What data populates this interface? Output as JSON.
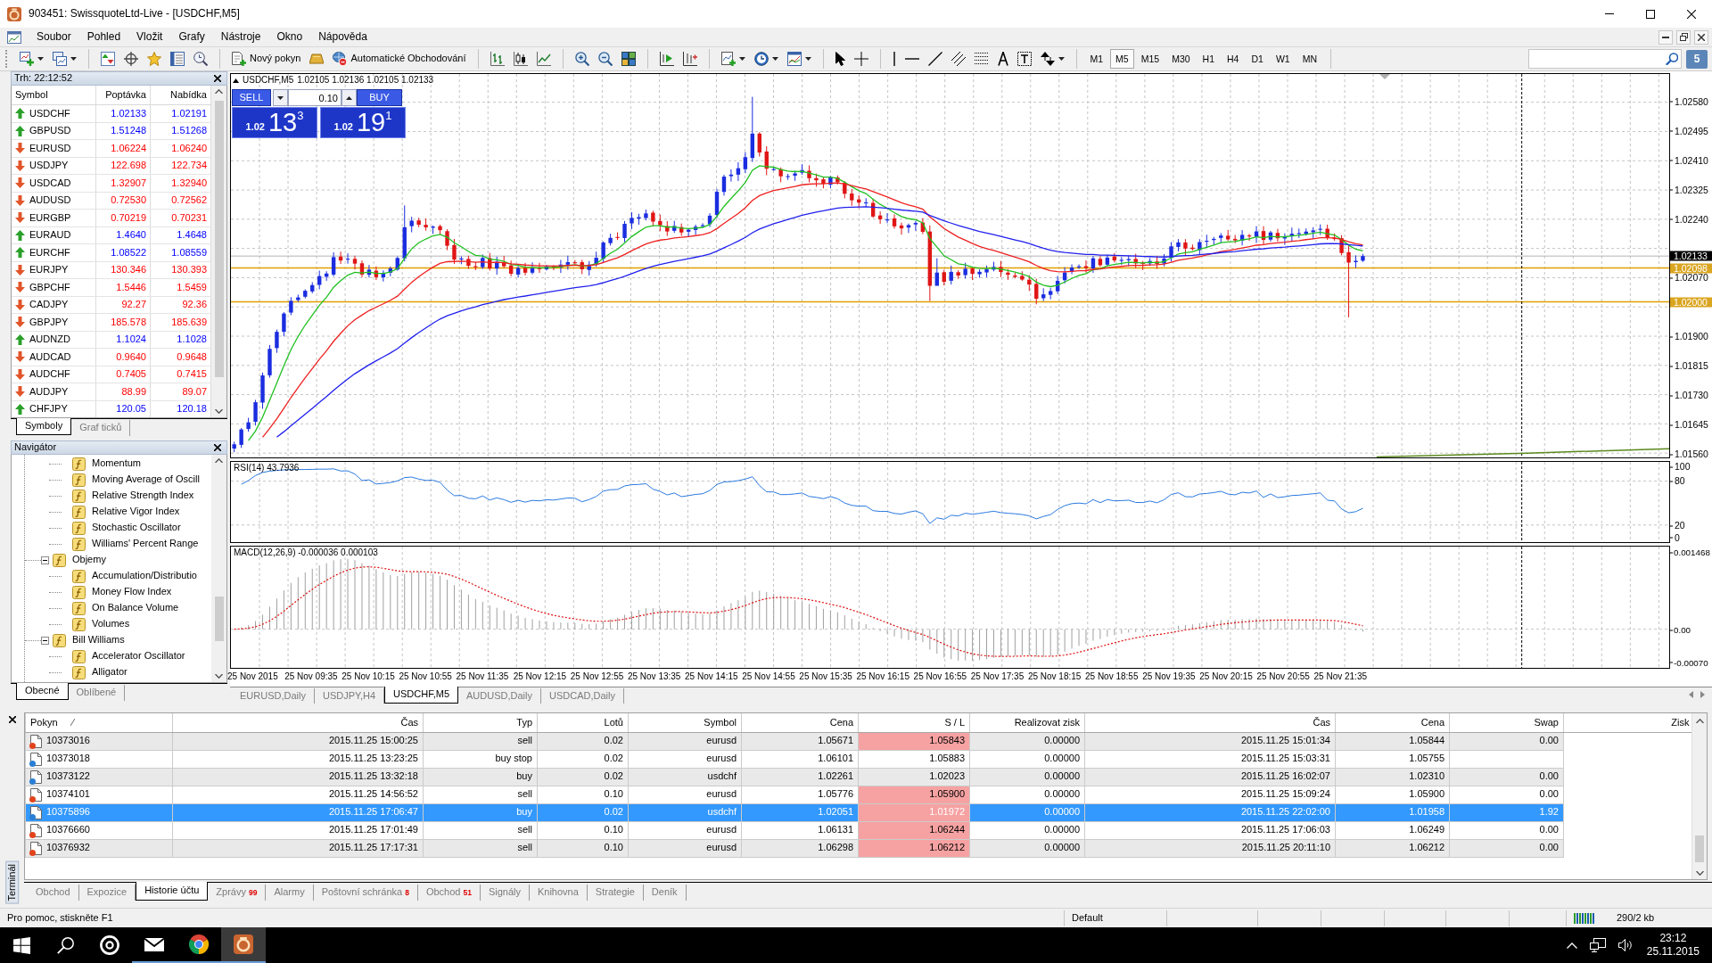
{
  "window": {
    "title": "903451: SwissquoteLtd-Live - [USDCHF,M5]"
  },
  "menu": [
    "Soubor",
    "Pohled",
    "Vložit",
    "Grafy",
    "Nástroje",
    "Okno",
    "Nápověda"
  ],
  "toolbar": {
    "new_order": "Nový pokyn",
    "auto_trading": "Automatické Obchodování",
    "periods": [
      {
        "label": "M1",
        "selected": false
      },
      {
        "label": "M5",
        "selected": true
      },
      {
        "label": "M15",
        "selected": false
      },
      {
        "label": "M30",
        "selected": false
      },
      {
        "label": "H1",
        "selected": false
      },
      {
        "label": "H4",
        "selected": false
      },
      {
        "label": "D1",
        "selected": false
      },
      {
        "label": "W1",
        "selected": false
      },
      {
        "label": "MN",
        "selected": false
      }
    ],
    "notifications": "5"
  },
  "market_watch": {
    "title": "Trh: 22:12:52",
    "columns": [
      "Symbol",
      "Poptávka",
      "Nabídka"
    ],
    "rows": [
      {
        "symbol": "USDCHF",
        "bid": "1.02133",
        "ask": "1.02191",
        "rising": true
      },
      {
        "symbol": "GBPUSD",
        "bid": "1.51248",
        "ask": "1.51268",
        "rising": true
      },
      {
        "symbol": "EURUSD",
        "bid": "1.06224",
        "ask": "1.06240",
        "rising": false
      },
      {
        "symbol": "USDJPY",
        "bid": "122.698",
        "ask": "122.734",
        "rising": false
      },
      {
        "symbol": "USDCAD",
        "bid": "1.32907",
        "ask": "1.32940",
        "rising": false
      },
      {
        "symbol": "AUDUSD",
        "bid": "0.72530",
        "ask": "0.72562",
        "rising": false
      },
      {
        "symbol": "EURGBP",
        "bid": "0.70219",
        "ask": "0.70231",
        "rising": false
      },
      {
        "symbol": "EURAUD",
        "bid": "1.4640",
        "ask": "1.4648",
        "rising": true
      },
      {
        "symbol": "EURCHF",
        "bid": "1.08522",
        "ask": "1.08559",
        "rising": true
      },
      {
        "symbol": "EURJPY",
        "bid": "130.346",
        "ask": "130.393",
        "rising": false
      },
      {
        "symbol": "GBPCHF",
        "bid": "1.5446",
        "ask": "1.5459",
        "rising": false
      },
      {
        "symbol": "CADJPY",
        "bid": "92.27",
        "ask": "92.36",
        "rising": false
      },
      {
        "symbol": "GBPJPY",
        "bid": "185.578",
        "ask": "185.639",
        "rising": false
      },
      {
        "symbol": "AUDNZD",
        "bid": "1.1024",
        "ask": "1.1028",
        "rising": true
      },
      {
        "symbol": "AUDCAD",
        "bid": "0.9640",
        "ask": "0.9648",
        "rising": false
      },
      {
        "symbol": "AUDCHF",
        "bid": "0.7405",
        "ask": "0.7415",
        "rising": false
      },
      {
        "symbol": "AUDJPY",
        "bid": "88.99",
        "ask": "89.07",
        "rising": false
      },
      {
        "symbol": "CHFJPY",
        "bid": "120.05",
        "ask": "120.18",
        "rising": true
      }
    ],
    "tabs": [
      {
        "label": "Symboly",
        "selected": true
      },
      {
        "label": "Graf ticků",
        "selected": false
      }
    ]
  },
  "navigator": {
    "title": "Navigátor",
    "tree": [
      {
        "children": [
          {
            "label": "Momentum"
          },
          {
            "label": "Moving Average of Oscill"
          },
          {
            "label": "Relative Strength Index"
          },
          {
            "label": "Relative Vigor Index"
          },
          {
            "label": "Stochastic Oscillator"
          },
          {
            "label": "Williams' Percent Range"
          }
        ]
      },
      {
        "label": "Objemy",
        "expanded": true,
        "children": [
          {
            "label": "Accumulation/Distributio"
          },
          {
            "label": "Money Flow Index"
          },
          {
            "label": "On Balance Volume"
          },
          {
            "label": "Volumes"
          }
        ]
      },
      {
        "label": "Bill Williams",
        "expanded": true,
        "children": [
          {
            "label": "Accelerator Oscillator"
          },
          {
            "label": "Alligator"
          }
        ]
      }
    ],
    "tabs": [
      {
        "label": "Obecné",
        "selected": true
      },
      {
        "label": "Oblíbené",
        "selected": false
      }
    ]
  },
  "chart": {
    "symbol": "USDCHF,M5",
    "ohlc": "1.02105 1.02136 1.02105 1.02133",
    "one_click": {
      "sell": "SELL",
      "buy": "BUY",
      "lots": "0.10",
      "sell_price": {
        "base": "1.02",
        "pips": "13",
        "point": "3"
      },
      "buy_price": {
        "base": "1.02",
        "pips": "19",
        "point": "1"
      }
    },
    "price_axis": [
      "1.02580",
      "1.02495",
      "1.02410",
      "1.02325",
      "1.02240",
      "1.02070",
      "1.01900",
      "1.01815",
      "1.01730",
      "1.01645",
      "1.01560"
    ],
    "price_labels": [
      {
        "text": "1.02133",
        "kind": "bid"
      },
      {
        "text": "1.02098",
        "kind": "level"
      },
      {
        "text": "1.02000",
        "kind": "level"
      }
    ],
    "rsi": {
      "label": "RSI(14) 43.7936",
      "axis": [
        "100",
        "80",
        "20",
        "0"
      ]
    },
    "macd": {
      "label": "MACD(12,26,9) -0.000036 0.000103",
      "axis": [
        "0.001468",
        "0.00",
        "-0.00070"
      ]
    },
    "time_axis": [
      "25 Nov 2015",
      "25 Nov 09:35",
      "25 Nov 10:15",
      "25 Nov 10:55",
      "25 Nov 11:35",
      "25 Nov 12:15",
      "25 Nov 12:55",
      "25 Nov 13:35",
      "25 Nov 14:15",
      "25 Nov 14:55",
      "25 Nov 15:35",
      "25 Nov 16:15",
      "25 Nov 16:55",
      "25 Nov 17:35",
      "25 Nov 18:15",
      "25 Nov 18:55",
      "25 Nov 19:35",
      "25 Nov 20:15",
      "25 Nov 20:55",
      "25 Nov 21:35"
    ]
  },
  "chart_tabs": [
    {
      "label": "EURUSD,Daily",
      "selected": false
    },
    {
      "label": "USDJPY,H4",
      "selected": false
    },
    {
      "label": "USDCHF,M5",
      "selected": true
    },
    {
      "label": "AUDUSD,Daily",
      "selected": false
    },
    {
      "label": "USDCAD,Daily",
      "selected": false
    }
  ],
  "terminal": {
    "title": "Terminál",
    "columns": [
      {
        "label": "Pokyn",
        "sorted": true
      },
      {
        "label": "Čas",
        "sorted": false
      },
      {
        "label": "Typ",
        "sorted": false
      },
      {
        "label": "Lotů",
        "sorted": false
      },
      {
        "label": "Symbol",
        "sorted": false
      },
      {
        "label": "Cena",
        "sorted": false
      },
      {
        "label": "S / L",
        "sorted": false
      },
      {
        "label": "Realizovat zisk",
        "sorted": false
      },
      {
        "label": "Čas",
        "sorted": false
      },
      {
        "label": "Cena",
        "sorted": false
      },
      {
        "label": "Swap",
        "sorted": false
      },
      {
        "label": "Zisk",
        "sorted": false
      }
    ],
    "rows": [
      {
        "order": "10373016",
        "open_time": "2015.11.25 15:00:25",
        "type": "sell",
        "lots": "0.02",
        "symbol": "eurusd",
        "open_price": "1.05671",
        "sl": "1.05843",
        "tp": "0.00000",
        "close_time": "2015.11.25 15:01:34",
        "close_price": "1.05844",
        "swap": "0.00",
        "color": "#e2431c",
        "sl_highlighted": true,
        "selected": false
      },
      {
        "order": "10373018",
        "open_time": "2015.11.25 13:23:25",
        "type": "buy stop",
        "lots": "0.02",
        "symbol": "eurusd",
        "open_price": "1.06101",
        "sl": "1.05883",
        "tp": "0.00000",
        "close_time": "2015.11.25 15:03:31",
        "close_price": "1.05755",
        "color": "#2a7fd4",
        "sl_highlighted": false,
        "selected": false
      },
      {
        "order": "10373122",
        "open_time": "2015.11.25 13:32:18",
        "type": "buy",
        "lots": "0.02",
        "symbol": "usdchf",
        "open_price": "1.02261",
        "sl": "1.02023",
        "tp": "0.00000",
        "close_time": "2015.11.25 16:02:07",
        "close_price": "1.02310",
        "swap": "0.00",
        "color": "#2a7fd4",
        "sl_highlighted": false,
        "selected": false
      },
      {
        "order": "10374101",
        "open_time": "2015.11.25 14:56:52",
        "type": "sell",
        "lots": "0.10",
        "symbol": "eurusd",
        "open_price": "1.05776",
        "sl": "1.05900",
        "tp": "0.00000",
        "close_time": "2015.11.25 15:09:24",
        "close_price": "1.05900",
        "swap": "0.00",
        "color": "#e2431c",
        "sl_highlighted": true,
        "selected": false
      },
      {
        "order": "10375896",
        "open_time": "2015.11.25 17:06:47",
        "type": "buy",
        "lots": "0.02",
        "symbol": "usdchf",
        "open_price": "1.02051",
        "sl": "1.01972",
        "tp": "0.00000",
        "close_time": "2015.11.25 22:02:00",
        "close_price": "1.01958",
        "swap": "1.92",
        "color": "#2a7fd4",
        "sl_highlighted": true,
        "selected": true
      },
      {
        "order": "10376660",
        "open_time": "2015.11.25 17:01:49",
        "type": "sell",
        "lots": "0.10",
        "symbol": "eurusd",
        "open_price": "1.06131",
        "sl": "1.06244",
        "tp": "0.00000",
        "close_time": "2015.11.25 17:06:03",
        "close_price": "1.06249",
        "swap": "0.00",
        "color": "#e2431c",
        "sl_highlighted": true,
        "selected": false
      },
      {
        "order": "10376932",
        "open_time": "2015.11.25 17:17:31",
        "type": "sell",
        "lots": "0.10",
        "symbol": "eurusd",
        "open_price": "1.06298",
        "sl": "1.06212",
        "tp": "0.00000",
        "close_time": "2015.11.25 20:11:10",
        "close_price": "1.06212",
        "swap": "0.00",
        "color": "#e2431c",
        "sl_highlighted": true,
        "selected": false
      }
    ],
    "tabs": [
      {
        "label": "Obchod",
        "selected": false
      },
      {
        "label": "Expozice",
        "selected": false
      },
      {
        "label": "Historie účtu",
        "selected": true
      },
      {
        "label": "Zprávy",
        "count": "99",
        "selected": false
      },
      {
        "label": "Alarmy",
        "selected": false
      },
      {
        "label": "Poštovní schránka",
        "count": "8",
        "selected": false
      },
      {
        "label": "Obchod",
        "count": "51",
        "selected": false
      },
      {
        "label": "Signály",
        "selected": false
      },
      {
        "label": "Knihovna",
        "selected": false
      },
      {
        "label": "Strategie",
        "selected": false
      },
      {
        "label": "Deník",
        "selected": false
      }
    ]
  },
  "status_bar": {
    "help": "Pro pomoc, stiskněte F1",
    "profile": "Default",
    "traffic": "290/2 kb"
  },
  "taskbar": {
    "time": "23:12",
    "date": "25.11.2015"
  }
}
